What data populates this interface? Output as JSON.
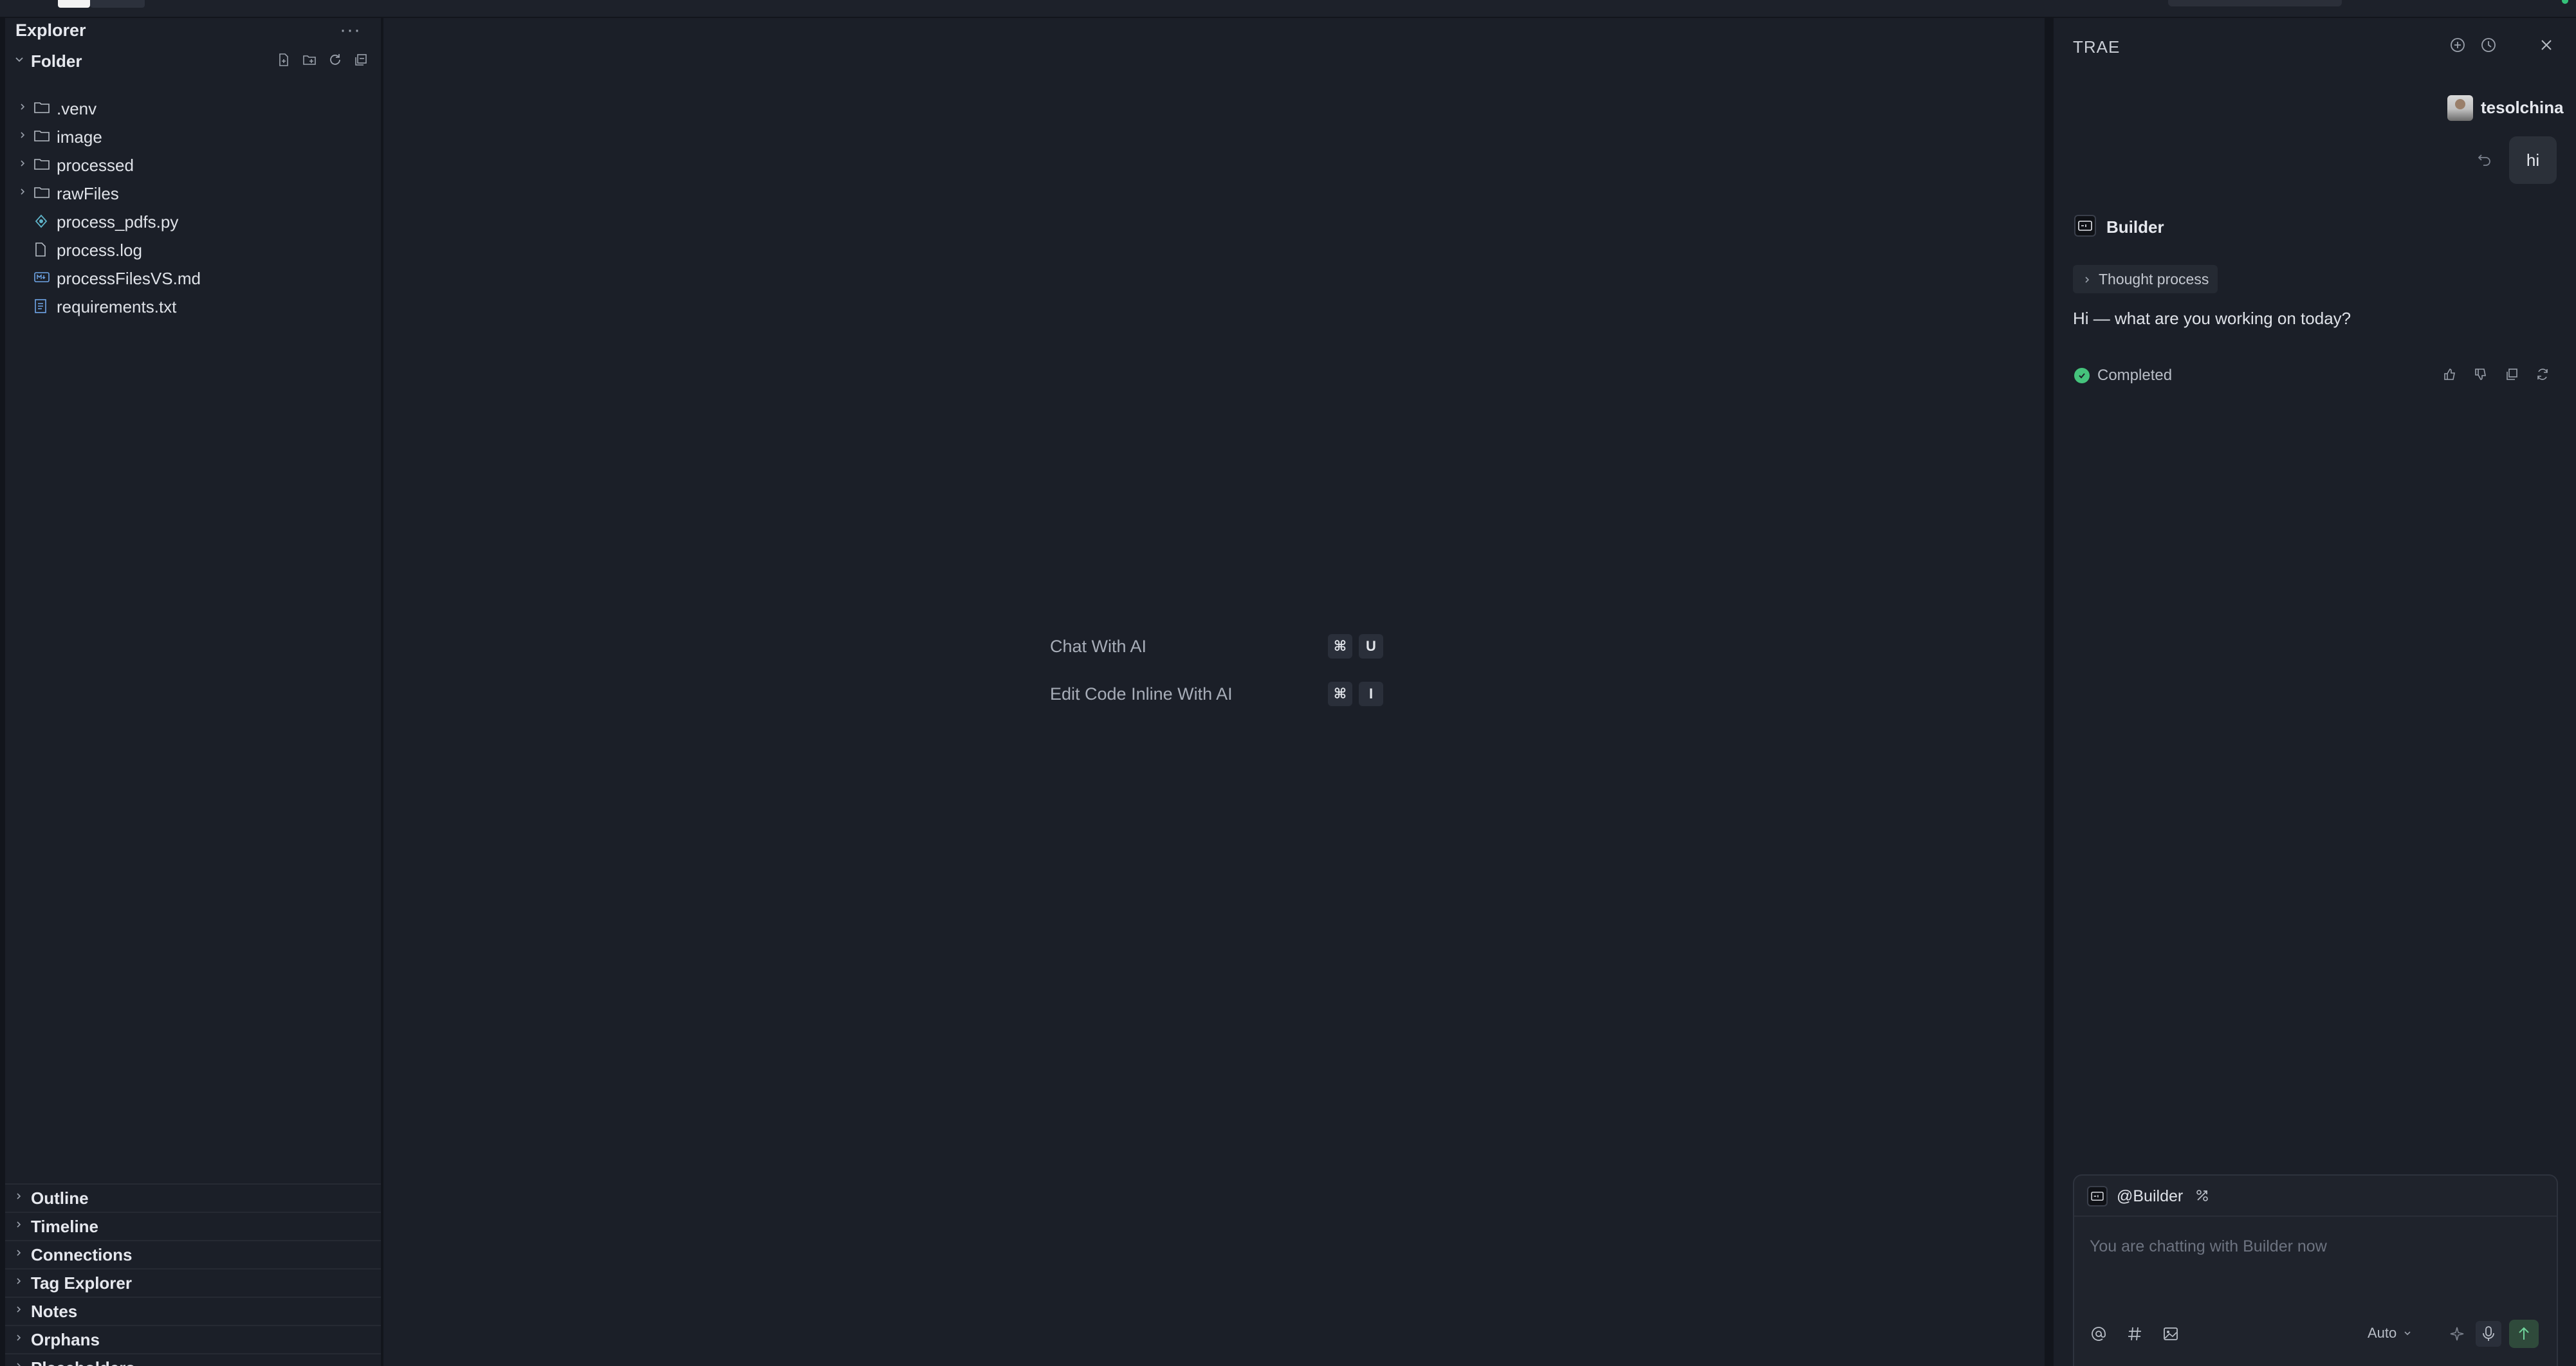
{
  "explorer": {
    "title": "Explorer",
    "more_label": "···",
    "folder_label": "Folder",
    "items": [
      {
        "name": ".venv",
        "type": "folder"
      },
      {
        "name": "image",
        "type": "folder"
      },
      {
        "name": "processed",
        "type": "folder"
      },
      {
        "name": "rawFiles",
        "type": "folder"
      },
      {
        "name": "process_pdfs.py",
        "type": "python"
      },
      {
        "name": "process.log",
        "type": "file"
      },
      {
        "name": "processFilesVS.md",
        "type": "markdown"
      },
      {
        "name": "requirements.txt",
        "type": "text"
      }
    ],
    "sections": [
      "Outline",
      "Timeline",
      "Connections",
      "Tag Explorer",
      "Notes",
      "Orphans",
      "Placeholders"
    ]
  },
  "editor": {
    "hints": [
      {
        "label": "Chat With AI",
        "keys": [
          "⌘",
          "U"
        ]
      },
      {
        "label": "Edit Code Inline With AI",
        "keys": [
          "⌘",
          "I"
        ]
      }
    ]
  },
  "chat": {
    "title": "TRAE",
    "user_name": "tesolchina",
    "user_message": "hi",
    "agent_name": "Builder",
    "thought_label": "Thought process",
    "reply": "Hi — what are you working on today?",
    "status": "Completed",
    "composer": {
      "tag_label": "@Builder",
      "placeholder": "You are chatting with Builder now",
      "model": "Auto"
    }
  },
  "colors": {
    "background": "#1b1f28",
    "panel_border": "#12151c",
    "success": "#45c37c",
    "send_button": "#2f4a3b"
  }
}
